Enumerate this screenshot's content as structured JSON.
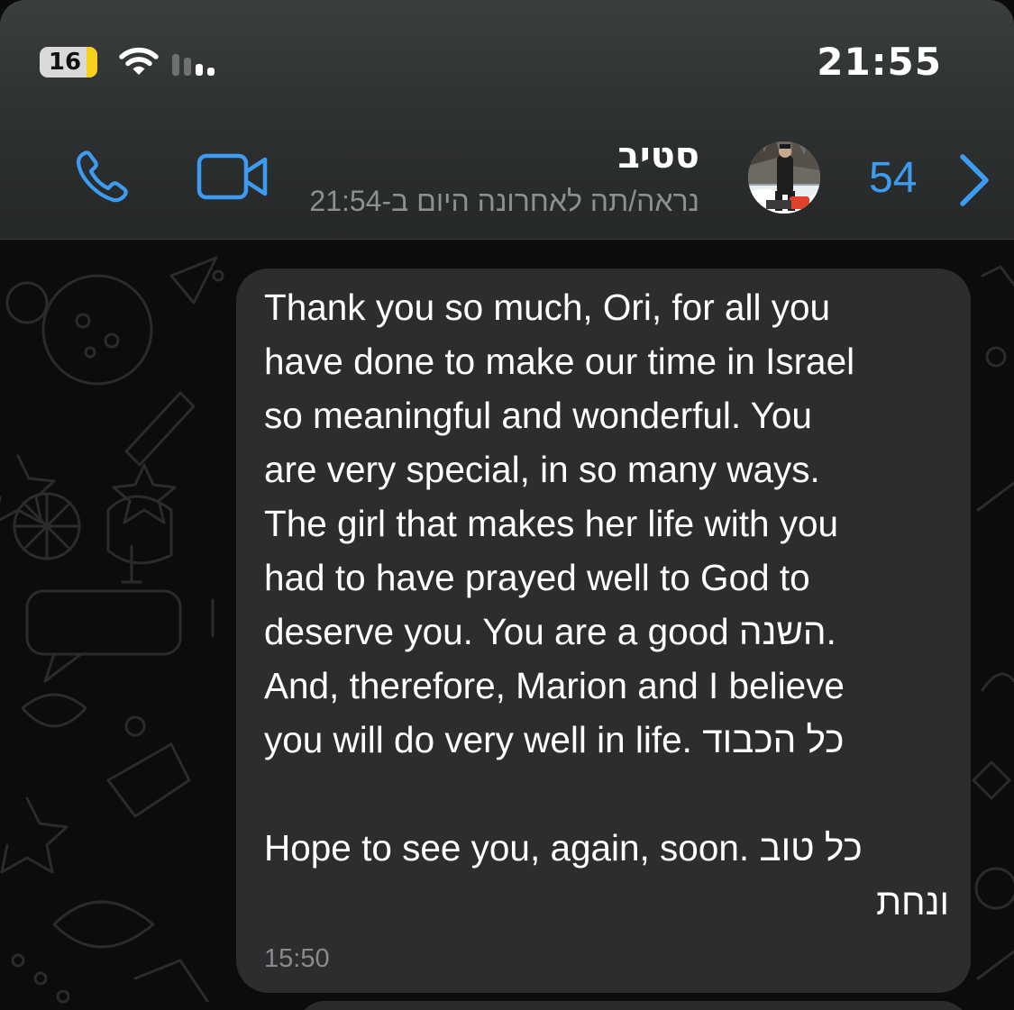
{
  "status_bar": {
    "battery_level": "16",
    "battery_icon": "battery-icon",
    "wifi_icon": "wifi-icon",
    "signal_icon": "cellular-signal-icon",
    "time": "21:55"
  },
  "chat_header": {
    "contact_name": "סטיב",
    "last_seen": "נראה/תה לאחרונה היום ב-21:54",
    "unread_count": "54",
    "back_icon": "chevron-right-icon",
    "call_icon": "phone-icon",
    "video_icon": "video-camera-icon",
    "accent_color": "#3d9cf2"
  },
  "messages": [
    {
      "direction": "incoming",
      "text": "Thank you so much, Ori, for all you\nhave done to make our time in Israel\nso meaningful and wonderful. You\nare very special, in so many ways.\nThe girl that makes her life with you\nhad to have prayed well to God to\ndeserve you. You are a good השנה.\nAnd, therefore, Marion and I believe\nyou will do very well in life. כל הכבוד\n\nHope to see you, again, soon. כל טוב\nונחת",
      "time": "15:50"
    }
  ]
}
